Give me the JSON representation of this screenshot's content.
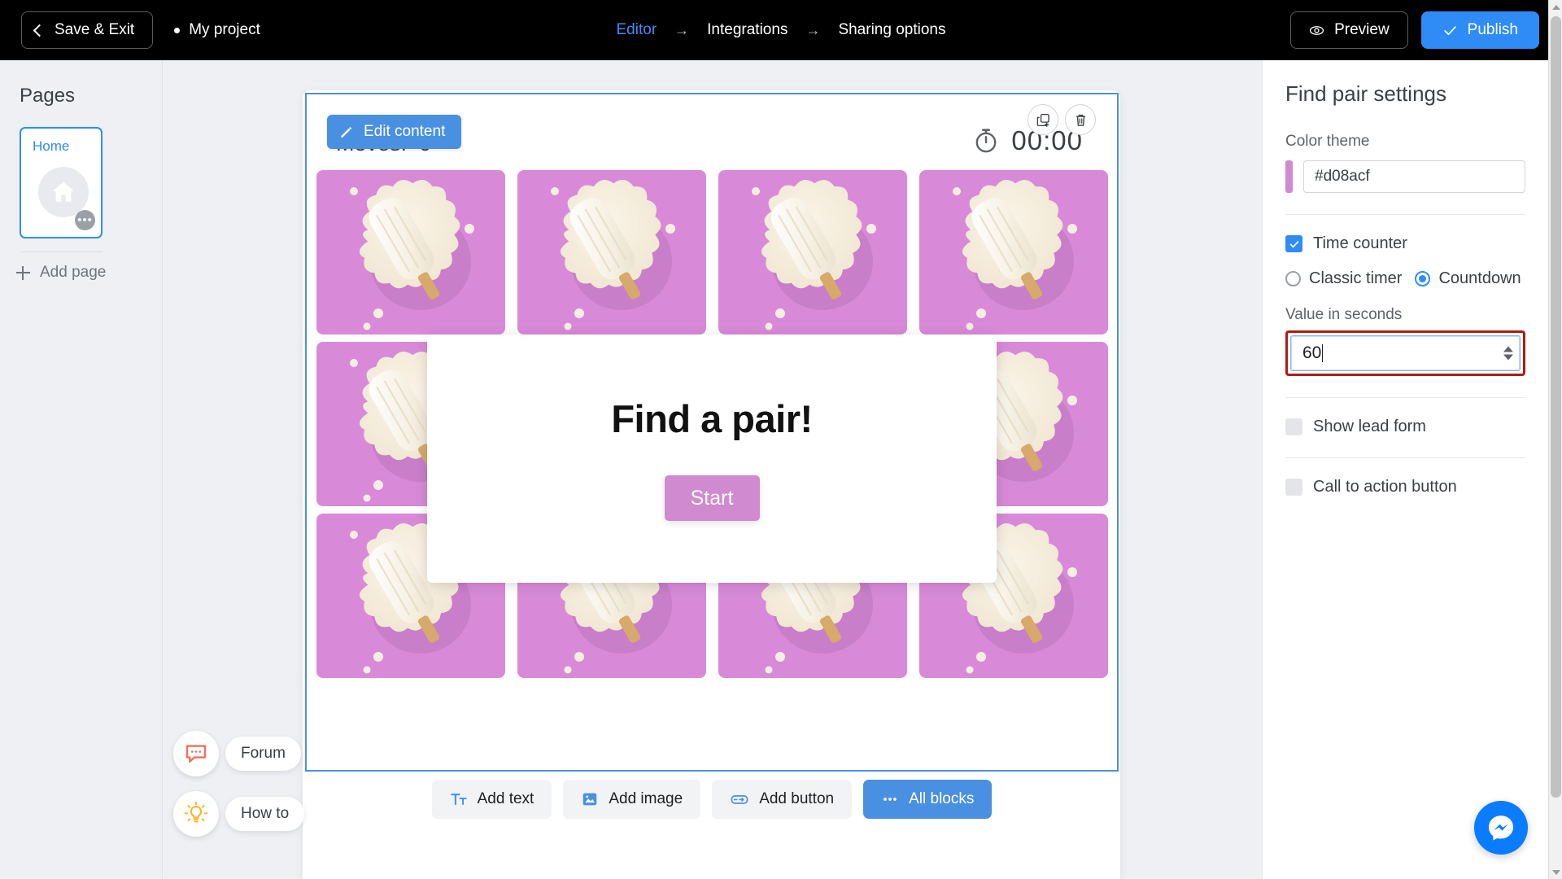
{
  "topbar": {
    "save_exit_label": "Save & Exit",
    "project_name": "My project",
    "steps": [
      {
        "label": "Editor",
        "active": true
      },
      {
        "label": "Integrations",
        "active": false
      },
      {
        "label": "Sharing options",
        "active": false
      }
    ],
    "arrow": "→",
    "preview_label": "Preview",
    "publish_label": "Publish"
  },
  "sidebar": {
    "title": "Pages",
    "page_card": {
      "label": "Home",
      "more_label": "•••"
    },
    "add_page_label": "Add page"
  },
  "help": {
    "forum_label": "Forum",
    "howto_label": "How to"
  },
  "canvas": {
    "edit_content_label": "Edit content",
    "moves_label": "Moves:",
    "moves_value": "0",
    "timer_value": "00:00",
    "tools": {
      "duplicate": "duplicate-icon",
      "delete": "trash-icon"
    },
    "modal": {
      "title": "Find a pair!",
      "start_label": "Start",
      "start_color": "#d08acf"
    },
    "cards": {
      "rows": 3,
      "cols": 4,
      "count": 12,
      "bg_color": "#d88ad8",
      "image_alt": "white popsicle on milk splash"
    },
    "add_bar": [
      {
        "label": "Add text",
        "icon": "text-icon",
        "primary": false
      },
      {
        "label": "Add image",
        "icon": "image-icon",
        "primary": false
      },
      {
        "label": "Add button",
        "icon": "button-icon",
        "primary": false
      },
      {
        "label": "All blocks",
        "icon": "dots-icon",
        "primary": true
      }
    ]
  },
  "right_panel": {
    "title": "Find pair settings",
    "color_theme_label": "Color theme",
    "color_value": "#d08acf",
    "color_swatch": "#d08acf",
    "time_counter_label": "Time counter",
    "time_counter_checked": true,
    "timer_modes": [
      {
        "label": "Classic timer",
        "selected": false
      },
      {
        "label": "Countdown",
        "selected": true
      }
    ],
    "value_seconds_label": "Value in seconds",
    "value_seconds": "60",
    "show_lead_form_label": "Show lead form",
    "show_lead_form_checked": false,
    "cta_label": "Call to action button",
    "cta_checked": false
  },
  "messenger": {
    "name": "messenger-icon"
  }
}
